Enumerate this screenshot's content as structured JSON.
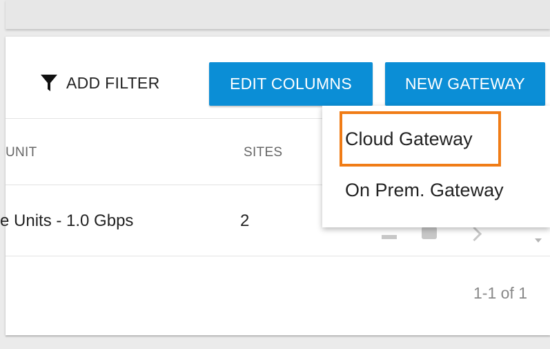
{
  "toolbar": {
    "add_filter_label": "ADD FILTER",
    "edit_columns_label": "EDIT COLUMNS",
    "new_gateway_label": "NEW GATEWAY",
    "filter_icon": "filter-icon"
  },
  "table": {
    "headers": [
      "UNIT",
      "SITES"
    ],
    "rows": [
      {
        "unit": "e Units - 1.0 Gbps",
        "sites": "2"
      }
    ]
  },
  "pagination": {
    "text": "1-1 of 1"
  },
  "dropdown": {
    "items": [
      "Cloud Gateway",
      "On Prem. Gateway"
    ],
    "highlighted_item": "Cloud Gateway"
  },
  "colors": {
    "button_primary": "#0b8ed6",
    "highlight_border": "#f07c16"
  }
}
